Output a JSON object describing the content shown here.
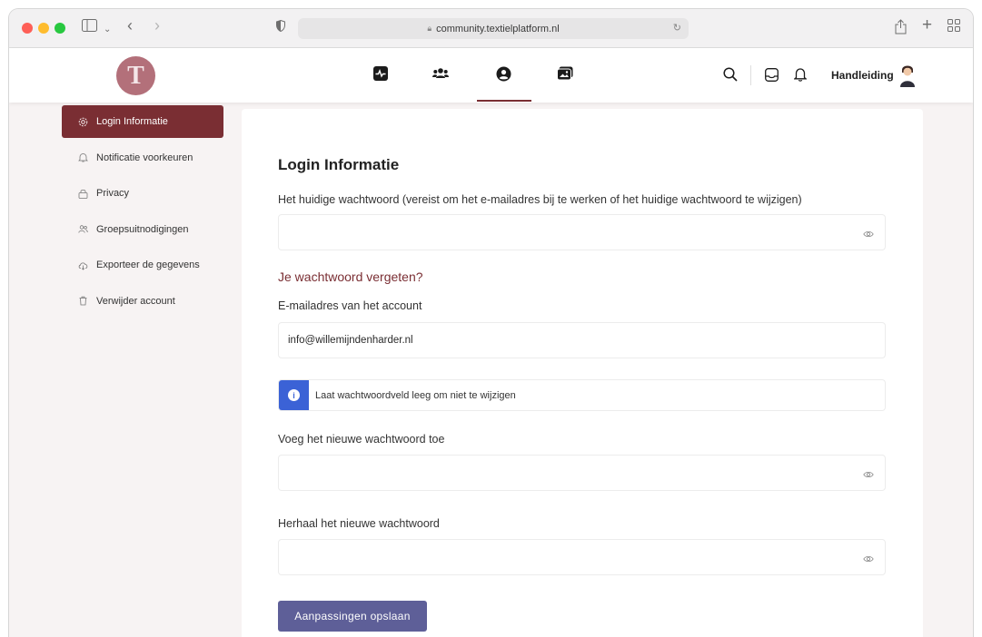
{
  "browser": {
    "url": "community.textielplatform.nl"
  },
  "header": {
    "logo_letter": "T",
    "user_label": "Handleiding",
    "nav_icons": [
      "activity-icon",
      "groups-icon",
      "profile-icon",
      "photos-icon"
    ],
    "active_nav": "profile-icon"
  },
  "sidebar": {
    "items": [
      {
        "label": "Login Informatie",
        "icon": "gear-icon",
        "active": true
      },
      {
        "label": "Notificatie voorkeuren",
        "icon": "bell-icon",
        "active": false
      },
      {
        "label": "Privacy",
        "icon": "lock-icon",
        "active": false
      },
      {
        "label": "Groepsuitnodigingen",
        "icon": "users-icon",
        "active": false
      },
      {
        "label": "Exporteer de gegevens",
        "icon": "cloud-download-icon",
        "active": false
      },
      {
        "label": "Verwijder account",
        "icon": "trash-icon",
        "active": false
      }
    ]
  },
  "main": {
    "title": "Login Informatie",
    "current_password_label": "Het huidige wachtwoord (vereist om het e-mailadres bij te werken of het huidige wachtwoord te wijzigen)",
    "current_password_value": "",
    "forgot_link": "Je wachtwoord vergeten?",
    "email_label": "E-mailadres van het account",
    "email_value": "info@willemijndenharder.nl",
    "notice_text": "Laat wachtwoordveld leeg om niet te wijzigen",
    "new_password_label": "Voeg het nieuwe wachtwoord toe",
    "new_password_value": "",
    "repeat_password_label": "Herhaal het nieuwe wachtwoord",
    "repeat_password_value": "",
    "save_button": "Aanpassingen opslaan"
  },
  "colors": {
    "accent": "#7a2e33",
    "button": "#5e5f98",
    "info": "#3b62d6",
    "logo": "#b3707a"
  }
}
